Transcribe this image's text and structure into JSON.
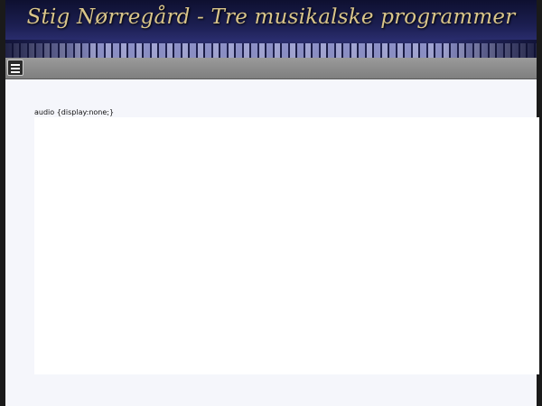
{
  "banner": {
    "title": "Stig Nørregård - Tre musikalske programmer"
  },
  "navbar": {
    "menu_icon": "hamburger-menu-icon"
  },
  "main": {
    "css_text": "audio {display:none;}"
  }
}
